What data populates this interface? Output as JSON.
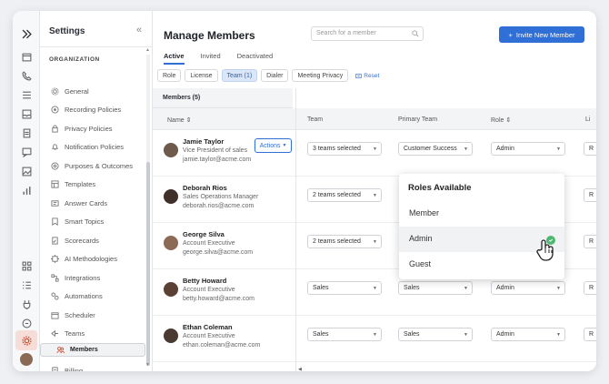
{
  "sidebar": {
    "title": "Settings",
    "collapse_glyph": "«",
    "section": "ORGANIZATION",
    "items": [
      {
        "label": "General",
        "icon": "gear-icon"
      },
      {
        "label": "Recording Policies",
        "icon": "record-icon"
      },
      {
        "label": "Privacy Policies",
        "icon": "lock-icon"
      },
      {
        "label": "Notification Policies",
        "icon": "bell-icon"
      },
      {
        "label": "Purposes & Outcomes",
        "icon": "target-icon"
      },
      {
        "label": "Templates",
        "icon": "template-icon"
      },
      {
        "label": "Answer Cards",
        "icon": "card-icon"
      },
      {
        "label": "Smart Topics",
        "icon": "topic-icon"
      },
      {
        "label": "Scorecards",
        "icon": "scorecard-icon"
      },
      {
        "label": "AI Methodologies",
        "icon": "ai-icon"
      },
      {
        "label": "Integrations",
        "icon": "integration-icon"
      },
      {
        "label": "Automations",
        "icon": "automation-icon"
      },
      {
        "label": "Scheduler",
        "icon": "calendar-icon"
      },
      {
        "label": "Teams",
        "icon": "teams-icon"
      },
      {
        "label": "Members",
        "icon": "members-icon"
      },
      {
        "label": "Billing",
        "icon": "billing-icon"
      }
    ],
    "selected": "Members"
  },
  "header": {
    "title": "Manage Members",
    "search_placeholder": "Search for a member",
    "invite_label": "Invite New Member"
  },
  "tabs": [
    {
      "label": "Active",
      "active": true
    },
    {
      "label": "Invited",
      "active": false
    },
    {
      "label": "Deactivated",
      "active": false
    }
  ],
  "filters": {
    "chips": [
      "Role",
      "License",
      "Team (1)",
      "Dialer",
      "Meeting Privacy"
    ],
    "active_chip": "Team (1)",
    "reset_label": "Reset"
  },
  "table": {
    "members_count_label": "Members (5)",
    "columns": {
      "name": "Name ⇕",
      "team": "Team",
      "primary_team": "Primary Team",
      "role": "Role ⇕",
      "license": "Li"
    },
    "actions_label": "Actions",
    "rows": [
      {
        "name": "Jamie Taylor",
        "title": "Vice President of sales",
        "email": "jamie.taylor@acme.com",
        "team": "3 teams selected",
        "primary_team": "Customer Success",
        "role": "Admin",
        "license": "R"
      },
      {
        "name": "Deborah Rios",
        "title": "Sales Operations Manager",
        "email": "deborah.rios@acme.com",
        "team": "2 teams selected",
        "primary_team": "",
        "role": "",
        "license": "R"
      },
      {
        "name": "George Silva",
        "title": "Account Executive",
        "email": "george.silva@acme.com",
        "team": "2 teams selected",
        "primary_team": "",
        "role": "",
        "license": "R"
      },
      {
        "name": "Betty Howard",
        "title": "Account Executive",
        "email": "betty.howard@acme.com",
        "team": "Sales",
        "primary_team": "Sales",
        "role": "Admin",
        "license": "R"
      },
      {
        "name": "Ethan Coleman",
        "title": "Account Executive",
        "email": "ethan.coleman@acme.com",
        "team": "Sales",
        "primary_team": "Sales",
        "role": "Admin",
        "license": "R"
      }
    ]
  },
  "roles_popup": {
    "title": "Roles Available",
    "options": [
      "Member",
      "Admin",
      "Guest"
    ],
    "highlighted": "Admin"
  },
  "colors": {
    "accent": "#2f6fd6",
    "active_rail": "#f6ddd7",
    "check": "#4db870"
  }
}
